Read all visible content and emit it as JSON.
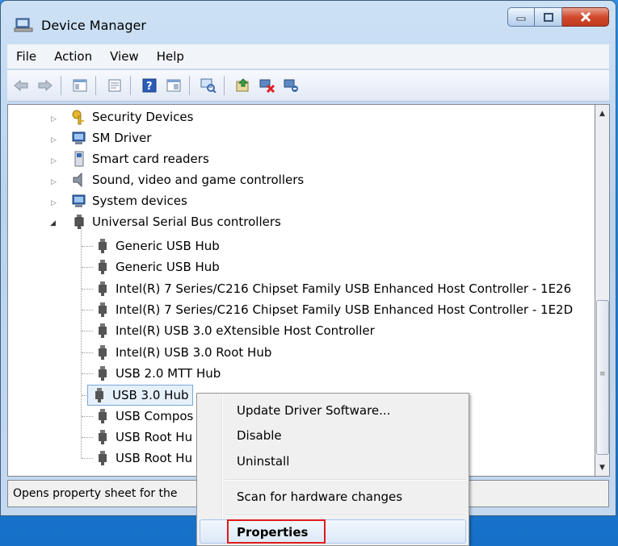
{
  "window": {
    "title": "Device Manager"
  },
  "menu": [
    "File",
    "Action",
    "View",
    "Help"
  ],
  "toolbar": {
    "buttons": [
      "back-icon",
      "forward-icon",
      "show-hide-tree-icon",
      "properties-icon",
      "help-icon",
      "view-icon",
      "scan-icon",
      "update-driver-icon",
      "uninstall-icon",
      "enable-icon"
    ]
  },
  "tree": {
    "categories": [
      {
        "label": "Security Devices",
        "icon": "security-devices-icon"
      },
      {
        "label": "SM Driver",
        "icon": "sm-driver-icon"
      },
      {
        "label": "Smart card readers",
        "icon": "smart-card-icon"
      },
      {
        "label": "Sound, video and game controllers",
        "icon": "sound-icon"
      },
      {
        "label": "System devices",
        "icon": "system-devices-icon"
      },
      {
        "label": "Universal Serial Bus controllers",
        "icon": "usb-icon"
      }
    ],
    "usb_children": [
      "Generic USB Hub",
      "Generic USB Hub",
      "Intel(R) 7 Series/C216 Chipset Family USB Enhanced Host Controller - 1E26",
      "Intel(R) 7 Series/C216 Chipset Family USB Enhanced Host Controller - 1E2D",
      "Intel(R) USB 3.0 eXtensible Host Controller",
      "Intel(R) USB 3.0 Root Hub",
      "USB 2.0 MTT Hub",
      "USB 3.0 Hub",
      "USB Compos",
      "USB Root Hu",
      "USB Root Hu"
    ]
  },
  "statusbar": {
    "text": "Opens property sheet for the"
  },
  "context_menu": {
    "items": [
      "Update Driver Software...",
      "Disable",
      "Uninstall",
      "Scan for hardware changes",
      "Properties"
    ]
  },
  "colors": {
    "highlight": "#e01b1b",
    "selection": "#e5f0fb"
  }
}
